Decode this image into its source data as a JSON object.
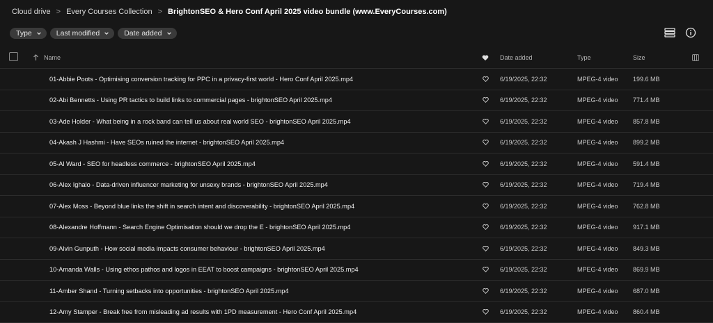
{
  "breadcrumb": [
    "Cloud drive",
    "Every Courses Collection",
    "BrightonSEO & Hero Conf April 2025 video bundle (www.EveryCourses.com)"
  ],
  "filters": [
    "Type",
    "Last modified",
    "Date added"
  ],
  "header": {
    "name": "Name",
    "date_added": "Date added",
    "type": "Type",
    "size": "Size"
  },
  "rows": [
    {
      "name": "01-Abbie Poots - Optimising conversion tracking for PPC in a privacy-first world - Hero Conf April 2025.mp4",
      "date": "6/19/2025, 22:32",
      "type": "MPEG-4 video",
      "size": "199.6 MB",
      "thumb": [
        "#5b2d8a",
        "#2a7ea8"
      ]
    },
    {
      "name": "02-Abi Bennetts - Using PR tactics to build links to commercial pages - brightonSEO April 2025.mp4",
      "date": "6/19/2025, 22:32",
      "type": "MPEG-4 video",
      "size": "771.4 MB",
      "thumb": [
        "#d98a6a",
        "#f1e2d6"
      ]
    },
    {
      "name": "03-Ade Holder - What being in a rock band can tell us about real world SEO - brightonSEO April 2025.mp4",
      "date": "6/19/2025, 22:32",
      "type": "MPEG-4 video",
      "size": "857.8 MB",
      "thumb": [
        "#c9d3e0",
        "#6f86a8"
      ]
    },
    {
      "name": "04-Akash J Hashmi - Have SEOs ruined the internet - brightonSEO April 2025.mp4",
      "date": "6/19/2025, 22:32",
      "type": "MPEG-4 video",
      "size": "899.2 MB",
      "thumb": [
        "#3a2b9c",
        "#8a4fd8"
      ]
    },
    {
      "name": "05-Al Ward - SEO for headless commerce - brightonSEO April 2025.mp4",
      "date": "6/19/2025, 22:32",
      "type": "MPEG-4 video",
      "size": "591.4 MB",
      "thumb": [
        "#1c2a6b",
        "#3f63c7"
      ]
    },
    {
      "name": "06-Alex Ighalo - Data-driven influencer marketing for unsexy brands - brightonSEO April 2025.mp4",
      "date": "6/19/2025, 22:32",
      "type": "MPEG-4 video",
      "size": "719.4 MB",
      "thumb": [
        "#a86bc8",
        "#e6d2f0"
      ]
    },
    {
      "name": "07-Alex Moss - Beyond blue links the shift in search intent and discoverability - brightonSEO April 2025.mp4",
      "date": "6/19/2025, 22:32",
      "type": "MPEG-4 video",
      "size": "762.8 MB",
      "thumb": [
        "#7a1f86",
        "#c43ea0"
      ]
    },
    {
      "name": "08-Alexandre Hoffmann - Search Engine Optimisation should we drop the E - brightonSEO April 2025.mp4",
      "date": "6/19/2025, 22:32",
      "type": "MPEG-4 video",
      "size": "917.1 MB",
      "thumb": [
        "#e8eef8",
        "#4c78c9"
      ]
    },
    {
      "name": "09-Alvin Gunputh - How social media impacts consumer behaviour - brightonSEO April 2025.mp4",
      "date": "6/19/2025, 22:32",
      "type": "MPEG-4 video",
      "size": "849.3 MB",
      "thumb": [
        "#14204f",
        "#2e3f8a"
      ]
    },
    {
      "name": "10-Amanda Walls - Using ethos pathos and logos in EEAT to boost campaigns - brightonSEO April 2025.mp4",
      "date": "6/19/2025, 22:32",
      "type": "MPEG-4 video",
      "size": "869.9 MB",
      "thumb": [
        "#1b2448",
        "#39508f"
      ]
    },
    {
      "name": "11-Amber Shand - Turning setbacks into opportunities - brightonSEO April 2025.mp4",
      "date": "6/19/2025, 22:32",
      "type": "MPEG-4 video",
      "size": "687.0 MB",
      "thumb": [
        "#3b2bb0",
        "#6a4fe0"
      ]
    },
    {
      "name": "12-Amy Stamper - Break free from misleading ad results with 1PD measurement - Hero Conf April 2025.mp4",
      "date": "6/19/2025, 22:32",
      "type": "MPEG-4 video",
      "size": "860.4 MB",
      "thumb": [
        "#c23a8e",
        "#f3c9e0"
      ]
    }
  ]
}
